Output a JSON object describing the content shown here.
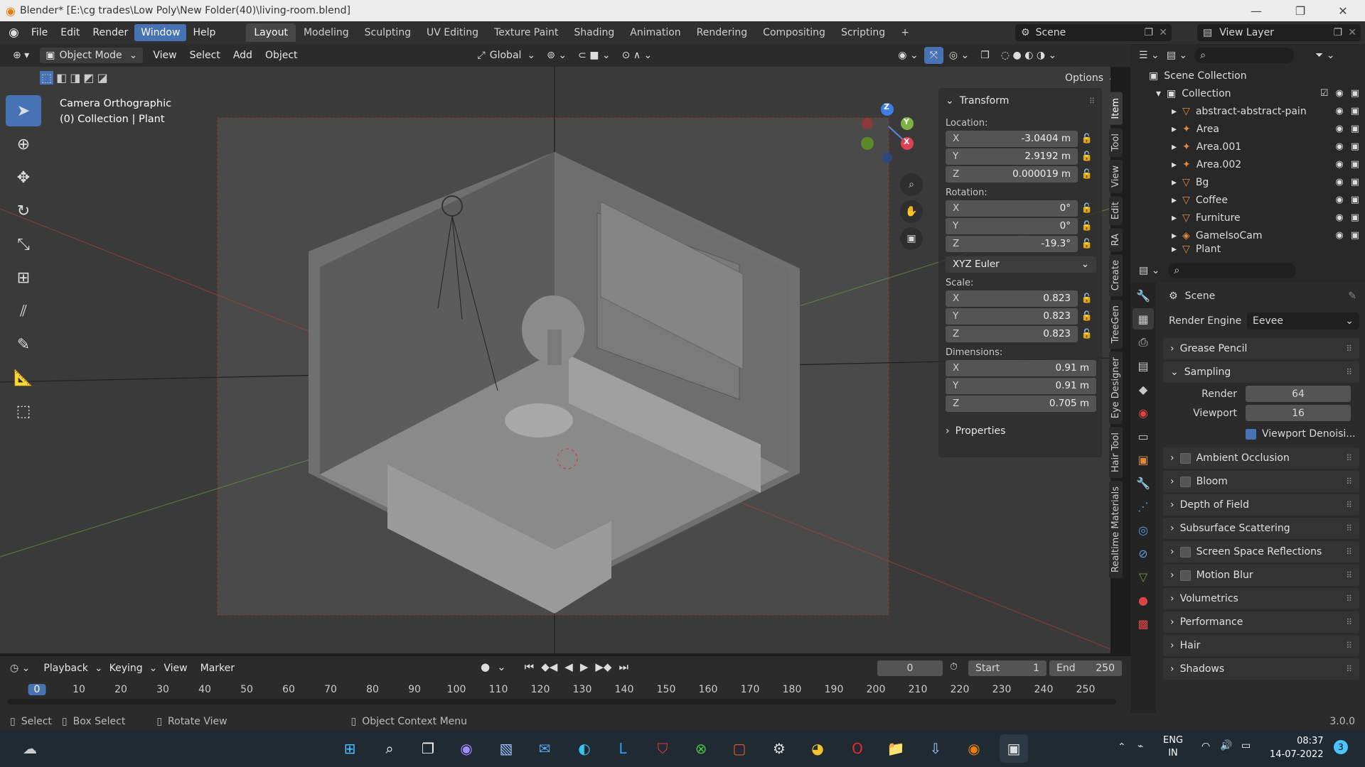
{
  "window": {
    "title": "Blender* [E:\\cg trades\\Low Poly\\New Folder(40)\\living-room.blend]",
    "controls": [
      "—",
      "❐",
      "✕"
    ]
  },
  "menu": {
    "items": [
      "File",
      "Edit",
      "Render",
      "Window",
      "Help"
    ],
    "active": "Window"
  },
  "workspaces": {
    "tabs": [
      "Layout",
      "Modeling",
      "Sculpting",
      "UV Editing",
      "Texture Paint",
      "Shading",
      "Animation",
      "Rendering",
      "Compositing",
      "Scripting",
      "+"
    ],
    "active": "Layout"
  },
  "scene": {
    "label": "Scene",
    "view_layer": "View Layer"
  },
  "viewport_header": {
    "mode": "Object Mode",
    "menus": [
      "View",
      "Select",
      "Add",
      "Object"
    ],
    "transform_orientation": "Global",
    "options": "Options"
  },
  "viewport": {
    "camera_label": "Camera Orthographic",
    "collection_label": "(0) Collection | Plant",
    "gizmo": {
      "x": "X",
      "y": "Y",
      "z": "Z"
    }
  },
  "npanel": {
    "section": "Transform",
    "location_label": "Location:",
    "location": {
      "x": "-3.0404 m",
      "y": "2.9192 m",
      "z": "0.000019 m"
    },
    "rotation_label": "Rotation:",
    "rotation": {
      "x": "0°",
      "y": "0°",
      "z": "-19.3°"
    },
    "rotation_mode": "XYZ Euler",
    "scale_label": "Scale:",
    "scale": {
      "x": "0.823",
      "y": "0.823",
      "z": "0.823"
    },
    "dimensions_label": "Dimensions:",
    "dimensions": {
      "x": "0.91 m",
      "y": "0.91 m",
      "z": "0.705 m"
    },
    "properties": "Properties",
    "axis": {
      "x": "X",
      "y": "Y",
      "z": "Z"
    },
    "tabs": [
      "Item",
      "Tool",
      "View",
      "Edit",
      "RA",
      "Create",
      "TreeGen",
      "Eye Designer",
      "Hair Tool",
      "Realtime Materials"
    ]
  },
  "outliner": {
    "root": "Scene Collection",
    "collection": "Collection",
    "items": [
      "abstract-abstract-pain",
      "Area",
      "Area.001",
      "Area.002",
      "Bg",
      "Coffee",
      "Furniture",
      "GameIsoCam",
      "Plant"
    ]
  },
  "properties": {
    "scene": "Scene",
    "render_engine_label": "Render Engine",
    "render_engine": "Eevee",
    "sections": {
      "grease_pencil": "Grease Pencil",
      "sampling": "Sampling",
      "render_label": "Render",
      "render_value": "64",
      "viewport_label": "Viewport",
      "viewport_value": "16",
      "viewport_denoise": "Viewport Denoisi...",
      "ambient_occlusion": "Ambient Occlusion",
      "bloom": "Bloom",
      "depth_of_field": "Depth of Field",
      "subsurface": "Subsurface Scattering",
      "ssr": "Screen Space Reflections",
      "motion_blur": "Motion Blur",
      "volumetrics": "Volumetrics",
      "performance": "Performance",
      "hair": "Hair",
      "shadows": "Shadows"
    }
  },
  "timeline": {
    "menus": [
      "Playback",
      "Keying",
      "View",
      "Marker"
    ],
    "current_frame": "0",
    "start_label": "Start",
    "start": "1",
    "end_label": "End",
    "end": "250",
    "ticks": [
      "0",
      "10",
      "20",
      "30",
      "40",
      "50",
      "60",
      "70",
      "80",
      "90",
      "100",
      "110",
      "120",
      "130",
      "140",
      "150",
      "160",
      "170",
      "180",
      "190",
      "200",
      "210",
      "220",
      "230",
      "240",
      "250"
    ]
  },
  "statusbar": {
    "select": "Select",
    "box_select": "Box Select",
    "rotate_view": "Rotate View",
    "context_menu": "Object Context Menu",
    "version": "3.0.0"
  },
  "taskbar": {
    "lang1": "ENG",
    "lang2": "IN",
    "time": "08:37",
    "date": "14-07-2022",
    "notif": "3"
  },
  "colors": {
    "accent": "#4772b3",
    "axis_x": "#e04150",
    "axis_y": "#7cb342",
    "axis_z": "#3d7ee8"
  }
}
